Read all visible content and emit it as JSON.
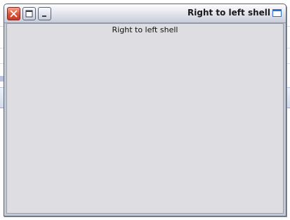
{
  "window": {
    "title": "Right to left shell",
    "buttons": {
      "close_icon": "close-icon",
      "maximize_icon": "maximize-icon",
      "minimize_icon": "minimize-icon"
    },
    "window_icon": "window-icon"
  },
  "content": {
    "label": "Right to left shell"
  },
  "colors": {
    "client_background": "#dedde2",
    "frame": "#c4c9d6",
    "close_button": "#d8543a",
    "window_icon_accent": "#2f6fd0"
  }
}
